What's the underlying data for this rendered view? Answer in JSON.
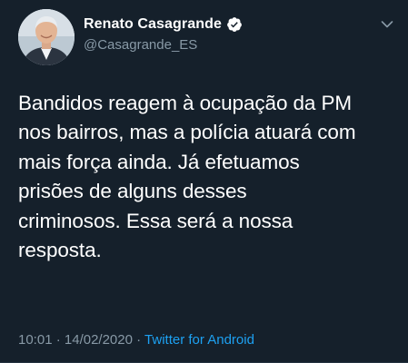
{
  "tweet": {
    "author": {
      "display_name": "Renato Casagrande",
      "handle": "@Casagrande_ES",
      "verified": true,
      "avatar_icon": "profile-photo"
    },
    "text": "Bandidos reagem à ocupação da PM\nnos bairros, mas a polícia atuará com\nmais força ainda. Já efetuamos\nprisões de alguns desses\ncriminosos. Essa será a nossa\nresposta.",
    "time": "10:01",
    "separator": "·",
    "date": "14/02/2020",
    "source": "Twitter for Android",
    "menu_icon": "chevron-down-icon"
  },
  "colors": {
    "background": "#15202b",
    "text": "#ffffff",
    "secondary_text": "#8899a6",
    "link": "#1da1f2"
  }
}
